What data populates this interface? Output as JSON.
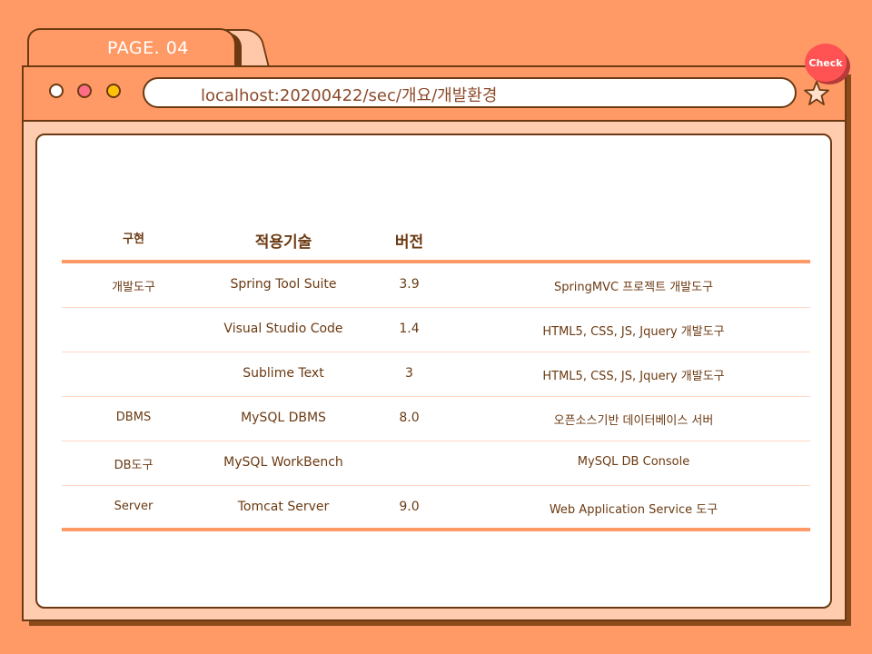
{
  "tab": {
    "label": "PAGE. 04"
  },
  "window_dots": [
    "close-dot",
    "minimize-dot",
    "maximize-dot"
  ],
  "address_bar": {
    "url": "localhost:20200422/sec/개요/개발환경"
  },
  "check_badge": {
    "label": "Check"
  },
  "icons": {
    "bookmark": "star-icon"
  },
  "colors": {
    "background": "#FF9A66",
    "border": "#6B3A12",
    "badge": "#FF5252",
    "text": "#6B3A12"
  },
  "table": {
    "headers": [
      "구현",
      "적용기술",
      "버전",
      ""
    ],
    "rows": [
      [
        "개발도구",
        "Spring Tool Suite",
        "3.9",
        "SpringMVC 프로젝트 개발도구"
      ],
      [
        "",
        "Visual Studio Code",
        "1.4",
        "HTML5, CSS, JS, Jquery 개발도구"
      ],
      [
        "",
        "Sublime Text",
        "3",
        "HTML5, CSS, JS, Jquery 개발도구"
      ],
      [
        "DBMS",
        "MySQL DBMS",
        "8.0",
        "오픈소스기반 데이터베이스 서버"
      ],
      [
        "DB도구",
        "MySQL WorkBench",
        "",
        "MySQL DB Console"
      ],
      [
        "Server",
        "Tomcat Server",
        "9.0",
        "Web Application Service 도구"
      ]
    ]
  }
}
